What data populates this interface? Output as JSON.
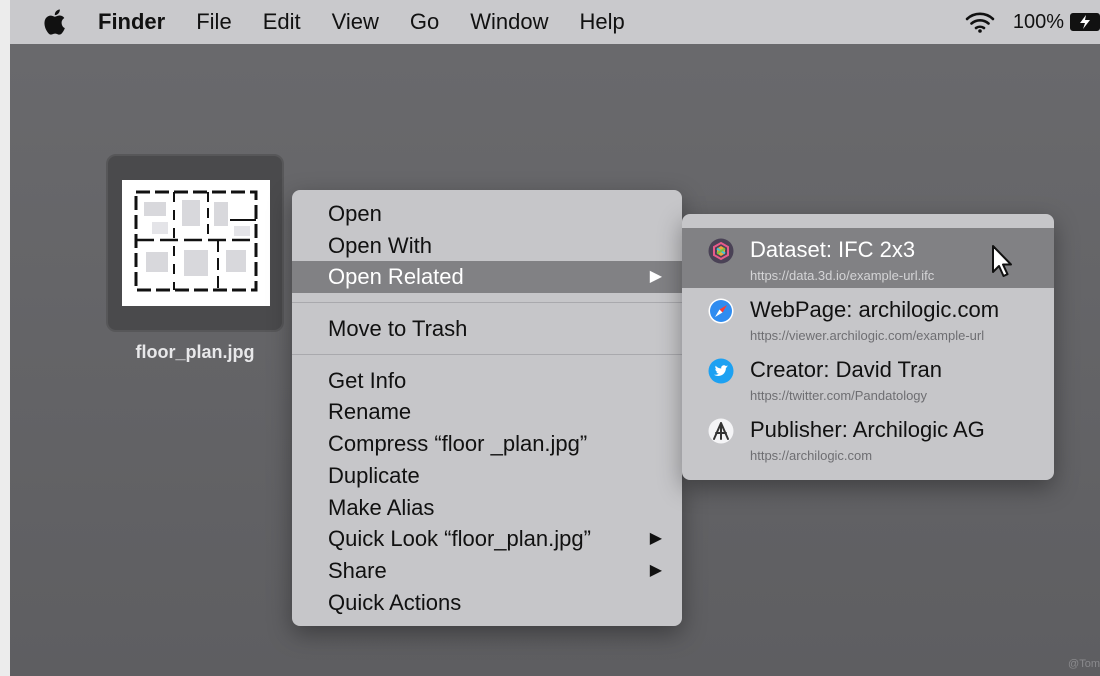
{
  "menubar": {
    "apple_icon": "apple-logo-icon",
    "app_name": "Finder",
    "items": [
      "File",
      "Edit",
      "View",
      "Go",
      "Window",
      "Help"
    ],
    "wifi_icon": "wifi-icon",
    "battery_percent": "100%",
    "battery_icon": "battery-charging-icon"
  },
  "desktop": {
    "file": {
      "name": "floor_plan.jpg",
      "thumbnail": "floor-plan-thumbnail"
    }
  },
  "context_menu": {
    "group1": [
      {
        "label": "Open",
        "arrow": ""
      },
      {
        "label": "Open With",
        "arrow": ""
      },
      {
        "label": "Open Related",
        "arrow": "▶",
        "selected": true
      }
    ],
    "group2": [
      {
        "label": "Move to Trash"
      }
    ],
    "group3": [
      {
        "label": "Get Info",
        "arrow": ""
      },
      {
        "label": "Rename",
        "arrow": ""
      },
      {
        "label": "Compress “floor _plan.jpg”",
        "arrow": ""
      },
      {
        "label": "Duplicate",
        "arrow": ""
      },
      {
        "label": "Make Alias",
        "arrow": ""
      },
      {
        "label": "Quick Look “floor_plan.jpg”",
        "arrow": "▶"
      },
      {
        "label": "Share",
        "arrow": "▶"
      },
      {
        "label": "Quick Actions",
        "arrow": ""
      }
    ]
  },
  "submenu": {
    "items": [
      {
        "title": "Dataset: IFC 2x3",
        "url": "https://data.3d.io/example-url.ifc",
        "icon": "dataset-icon",
        "selected": true
      },
      {
        "title": "WebPage: archilogic.com",
        "url": "https://viewer.archilogic.com/example-url",
        "icon": "safari-compass-icon"
      },
      {
        "title": "Creator: David Tran",
        "url": "https://twitter.com/Pandatology",
        "icon": "twitter-bird-icon"
      },
      {
        "title": "Publisher: Archilogic AG",
        "url": "https://archilogic.com",
        "icon": "archilogic-logo-icon"
      }
    ]
  },
  "watermark": "@Tom"
}
